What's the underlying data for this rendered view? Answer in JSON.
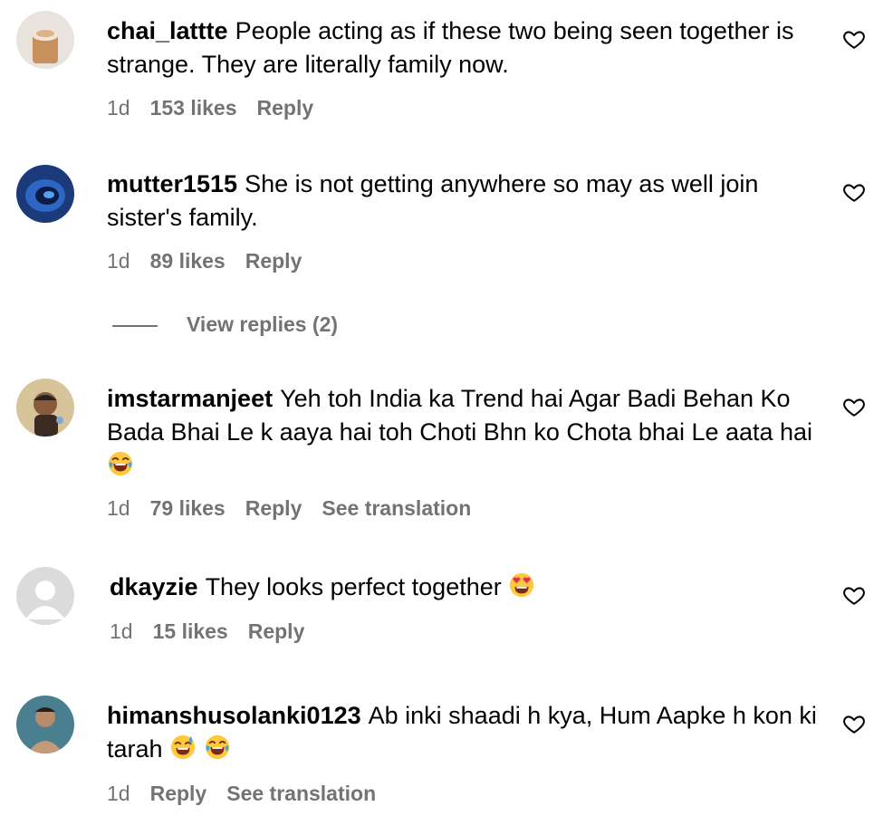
{
  "comments": [
    {
      "username": "chai_lattte",
      "text": "People acting as if these two being seen together is strange. They are literally family now.",
      "time": "1d",
      "likes": "153 likes",
      "reply": "Reply"
    },
    {
      "username": "mutter1515",
      "text": "She is not getting anywhere so may as well join sister's family.",
      "time": "1d",
      "likes": "89 likes",
      "reply": "Reply",
      "view_replies": "View replies (2)"
    },
    {
      "username": "imstarmanjeet",
      "text": "Yeh toh India ka Trend hai Agar Badi Behan Ko Bada Bhai Le k aaya hai toh Choti Bhn ko Chota bhai Le aata hai",
      "time": "1d",
      "likes": "79 likes",
      "reply": "Reply",
      "translate": "See translation"
    },
    {
      "username": "dkayzie",
      "text": "They looks perfect together",
      "time": "1d",
      "likes": "15 likes",
      "reply": "Reply"
    },
    {
      "username": "himanshusolanki0123",
      "text": "Ab inki shaadi h kya, Hum Aapke h kon ki tarah",
      "time": "1d",
      "reply": "Reply",
      "translate": "See translation"
    }
  ],
  "icons": {
    "like": "heart-outline-icon",
    "emoji_laugh": "face-with-tears-of-joy",
    "emoji_love": "smiling-face-with-heart-eyes",
    "emoji_sweat": "grinning-face-with-sweat"
  },
  "colors": {
    "text": "#000000",
    "meta": "#737373",
    "background": "#ffffff"
  }
}
